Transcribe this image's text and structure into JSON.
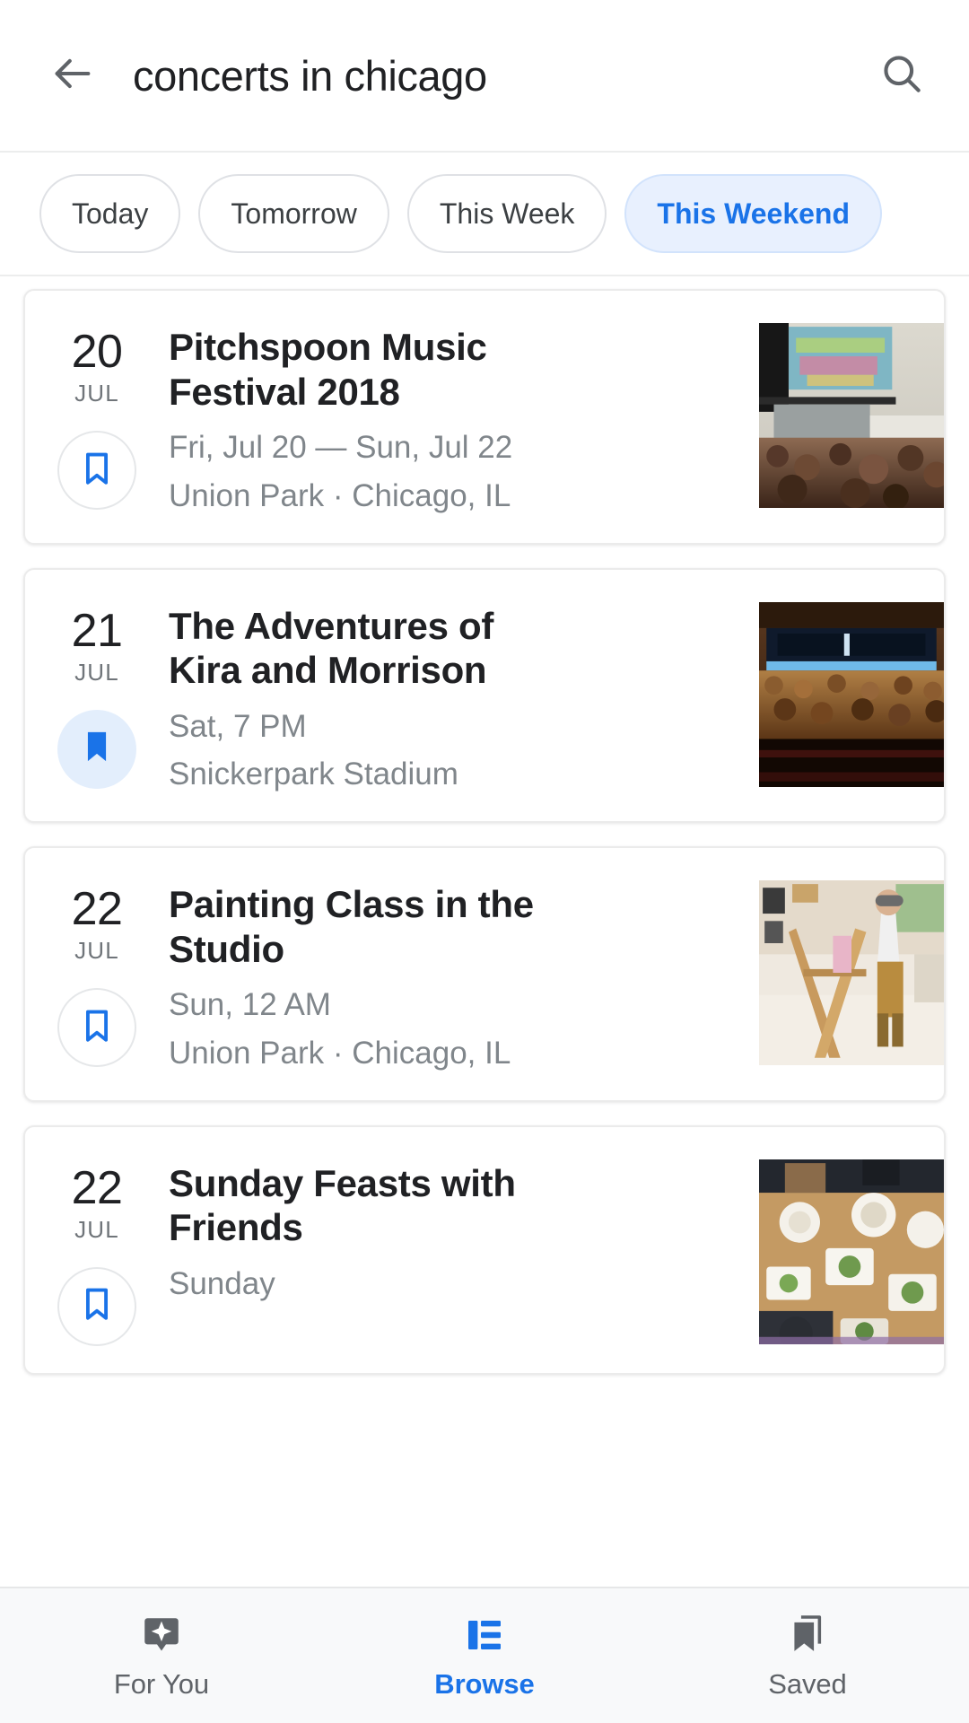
{
  "search": {
    "query": "concerts in chicago",
    "back_icon": "arrow-back-icon",
    "search_icon": "search-icon"
  },
  "filter_chips": [
    {
      "label": "Today",
      "active": false
    },
    {
      "label": "Tomorrow",
      "active": false
    },
    {
      "label": "This Week",
      "active": false
    },
    {
      "label": "This Weekend",
      "active": true
    }
  ],
  "events": [
    {
      "day": "20",
      "month": "JUL",
      "title": "Pitchspoon Music Festival 2018",
      "when": "Fri, Jul 20 — Sun, Jul 22",
      "where": "Union Park · Chicago, IL",
      "saved": false,
      "bookmark_icon": "bookmark-outline-icon",
      "thumb": "festival-crowd-stage-photo"
    },
    {
      "day": "21",
      "month": "JUL",
      "title": "The Adventures of Kira and Morrison",
      "when": "Sat, 7 PM",
      "where": "Snickerpark Stadium",
      "saved": true,
      "bookmark_icon": "bookmark-filled-icon",
      "thumb": "indoor-concert-audience-photo"
    },
    {
      "day": "22",
      "month": "JUL",
      "title": "Painting Class in the Studio",
      "when": "Sun, 12 AM",
      "where": "Union Park · Chicago, IL",
      "saved": false,
      "bookmark_icon": "bookmark-outline-icon",
      "thumb": "painting-studio-easel-photo"
    },
    {
      "day": "22",
      "month": "JUL",
      "title": "Sunday Feasts with Friends",
      "when": "Sunday",
      "where": "",
      "saved": false,
      "bookmark_icon": "bookmark-outline-icon",
      "thumb": "dinner-table-food-photo"
    }
  ],
  "bottom_nav": [
    {
      "label": "For You",
      "icon": "assistant-bubble-icon",
      "active": false
    },
    {
      "label": "Browse",
      "icon": "list-view-icon",
      "active": true
    },
    {
      "label": "Saved",
      "icon": "bookmarks-stack-icon",
      "active": false
    }
  ],
  "colors": {
    "accent": "#1a73e8",
    "chip_active_bg": "#e8f0fe",
    "text_primary": "#202124",
    "text_secondary": "#80868b",
    "nav_bg": "#f8f9fa"
  }
}
